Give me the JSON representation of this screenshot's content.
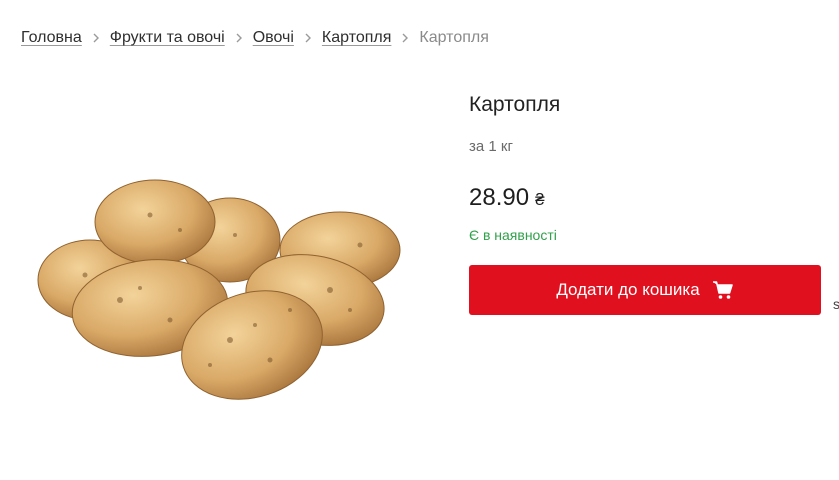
{
  "breadcrumb": {
    "items": [
      "Головна",
      "Фрукти та овочі",
      "Овочі",
      "Картопля",
      "Картопля"
    ]
  },
  "product": {
    "title": "Картопля",
    "unit": "за 1 кг",
    "price": "28.90",
    "currency": "₴",
    "stock_status": "Є в наявності",
    "add_to_cart_label": "Додати до кошика"
  },
  "side_glyph": "s",
  "colors": {
    "accent": "#e0101e",
    "in_stock": "#2fa14a"
  },
  "icons": {
    "breadcrumb_separator": "chevron-right-icon",
    "cart": "cart-icon"
  }
}
